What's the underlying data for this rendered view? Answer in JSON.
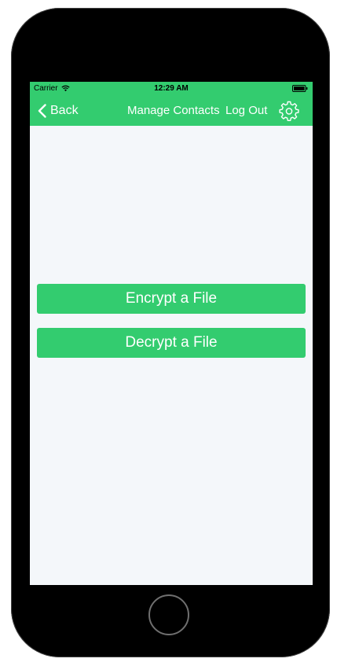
{
  "status_bar": {
    "carrier": "Carrier",
    "time": "12:29 AM",
    "wifi_icon": "wifi-icon",
    "battery_icon": "battery-full-icon"
  },
  "nav": {
    "back_label": "Back",
    "manage_contacts_label": "Manage Contacts",
    "log_out_label": "Log Out",
    "settings_icon": "gear-icon"
  },
  "actions": {
    "encrypt_label": "Encrypt a File",
    "decrypt_label": "Decrypt a File"
  },
  "colors": {
    "accent": "#33cc6f",
    "background": "#f4f7fa",
    "device_frame": "#000000"
  }
}
